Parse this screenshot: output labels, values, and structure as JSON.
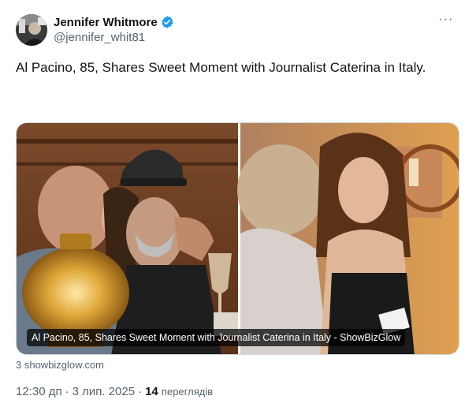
{
  "author": {
    "display_name": "Jennifer Whitmore",
    "handle": "@jennifer_whit81",
    "verified": true,
    "avatar_icon": "avatar-photo"
  },
  "menu": {
    "more_label": "···"
  },
  "tweet": {
    "text": "Al Pacino, 85, Shares Sweet Moment with Journalist Caterina in Italy."
  },
  "card": {
    "caption": "Al Pacino, 85, Shares Sweet Moment with Journalist Caterina in Italy - ShowBizGlow",
    "domain": "3 showbizglow.com"
  },
  "meta": {
    "time": "12:30 дп",
    "separator": "·",
    "date": "3 лип. 2025",
    "views_count": "14",
    "views_label": "переглядів"
  },
  "colors": {
    "verified_blue": "#1d9bf0",
    "text_primary": "#0f1419",
    "text_secondary": "#536471",
    "border": "#cfd9de"
  }
}
